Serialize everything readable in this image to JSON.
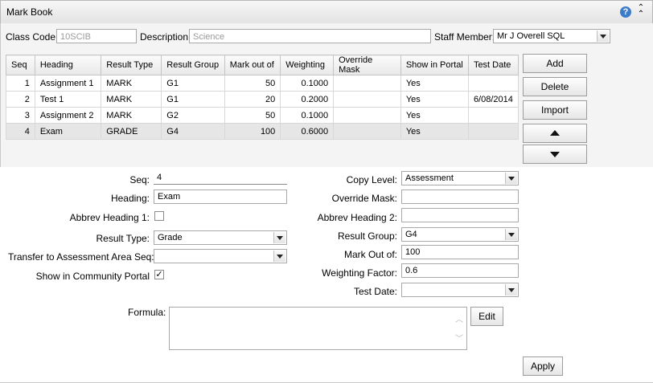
{
  "window": {
    "title": "Mark Book",
    "help_glyph": "?",
    "collapse_glyph": "⌃"
  },
  "header": {
    "class_code_label": "Class Code:",
    "class_code_value": "10SCIB",
    "description_label": "Description:",
    "description_value": "Science",
    "staff_label": "Staff Member:",
    "staff_value": "Mr J Overell SQL"
  },
  "table": {
    "columns": [
      "Seq",
      "Heading",
      "Result Type",
      "Result Group",
      "Mark out of",
      "Weighting",
      "Override Mask",
      "Show in Portal",
      "Test Date"
    ],
    "rows": [
      {
        "seq": "1",
        "heading": "Assignment 1",
        "result_type": "MARK",
        "result_group": "G1",
        "mark_out_of": "50",
        "weighting": "0.1000",
        "override_mask": "",
        "show_in_portal": "Yes",
        "test_date": ""
      },
      {
        "seq": "2",
        "heading": "Test 1",
        "result_type": "MARK",
        "result_group": "G1",
        "mark_out_of": "20",
        "weighting": "0.2000",
        "override_mask": "",
        "show_in_portal": "Yes",
        "test_date": "6/08/2014"
      },
      {
        "seq": "3",
        "heading": "Assignment 2",
        "result_type": "MARK",
        "result_group": "G2",
        "mark_out_of": "50",
        "weighting": "0.1000",
        "override_mask": "",
        "show_in_portal": "Yes",
        "test_date": ""
      },
      {
        "seq": "4",
        "heading": "Exam",
        "result_type": "GRADE",
        "result_group": "G4",
        "mark_out_of": "100",
        "weighting": "0.6000",
        "override_mask": "",
        "show_in_portal": "Yes",
        "test_date": ""
      }
    ],
    "selected_row": 3
  },
  "side_buttons": {
    "add": "Add",
    "delete": "Delete",
    "import": "Import",
    "move_up_icon": "triangle-up-icon",
    "move_down_icon": "triangle-down-icon"
  },
  "detail": {
    "seq_label": "Seq:",
    "seq_value": "4",
    "heading_label": "Heading:",
    "heading_value": "Exam",
    "abbrev1_label": "Abbrev Heading 1:",
    "abbrev1_checked": false,
    "result_type_label": "Result Type:",
    "result_type_value": "Grade",
    "transfer_label": "Transfer to Assessment Area Seq:",
    "transfer_value": "",
    "portal_label": "Show in Community Portal",
    "portal_checked": true,
    "check_glyph": "✓",
    "copy_level_label": "Copy Level:",
    "copy_level_value": "Assessment",
    "override_label": "Override Mask:",
    "override_value": "",
    "abbrev2_label": "Abbrev Heading 2:",
    "abbrev2_value": "",
    "result_group_label": "Result Group:",
    "result_group_value": "G4",
    "mark_out_of_label": "Mark Out of:",
    "mark_out_of_value": "100",
    "weighting_label": "Weighting Factor:",
    "weighting_value": "0.6",
    "test_date_label": "Test Date:",
    "test_date_value": "",
    "formula_label": "Formula:",
    "formula_value": "",
    "edit_button": "Edit",
    "apply_button": "Apply"
  }
}
